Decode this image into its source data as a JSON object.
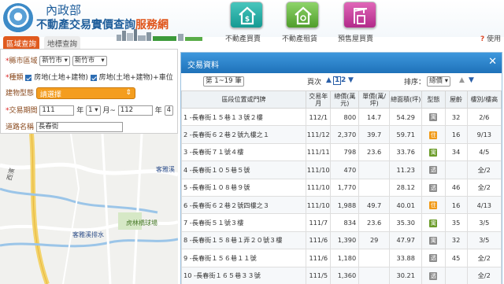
{
  "header": {
    "org": "內政部",
    "title_main": "不動產交易實價查詢",
    "title_accent": "服務網",
    "nav": [
      {
        "label": "不動產買賣",
        "icon": "house-dollar-icon"
      },
      {
        "label": "不動產租賃",
        "icon": "house-key-icon"
      },
      {
        "label": "預售屋買賣",
        "icon": "crane-building-icon"
      }
    ],
    "help": "使用"
  },
  "tabs": {
    "area": "區域查詢",
    "map": "地標查詢"
  },
  "filter": {
    "city_label": "縣市區域",
    "city_value": "新竹市",
    "district_value": "新竹市",
    "type_label": "種類",
    "type_opt1": "房地(土地+建物)",
    "type_opt2": "房地(土地+建物)+車位",
    "building_label": "建物型態",
    "building_value": "請選擇",
    "period_label": "交易期間",
    "year_from": "111",
    "unit_year": "年",
    "month_from": "1",
    "unit_month_to": "月~",
    "year_to": "112",
    "month_to": "4",
    "road_label": "道路名稱",
    "road_value": "長春街"
  },
  "map_labels": {
    "a": "客雅溪",
    "b": "虎林橋球場",
    "c": "客雅溪排水",
    "d": "西濱"
  },
  "dialog": {
    "title": "交易資料",
    "page_select": "第 1~19 筆",
    "page_label": "頁次",
    "page_current": "1",
    "page_next": "2",
    "sort_label": "排序：",
    "sort_value": "總價",
    "columns": [
      "區段位置或門牌",
      "交易年月",
      "總價(萬元)",
      "單價(萬/坪)",
      "總面積(坪)",
      "型態",
      "屋齡",
      "樓別/樓高"
    ],
    "rows": [
      {
        "addr": "1 -長春街１５巷１３號２樓",
        "date": "112/1",
        "total": "800",
        "unit": "14.7",
        "area": "54.29",
        "type": "apt",
        "type_char": "寓",
        "age": "32",
        "floor": "2/6"
      },
      {
        "addr": "2 -長春街６２巷２號九樓之１",
        "date": "111/12",
        "total": "2,370",
        "unit": "39.7",
        "area": "59.71",
        "type": "shop",
        "type_char": "住",
        "age": "16",
        "floor": "9/13"
      },
      {
        "addr": "3 -長春街７１號４樓",
        "date": "111/11",
        "total": "798",
        "unit": "23.6",
        "area": "33.76",
        "type": "building",
        "type_char": "寓",
        "age": "34",
        "floor": "4/5"
      },
      {
        "addr": "4 -長春街１０５巷５號",
        "date": "111/10",
        "total": "470",
        "unit": "",
        "area": "11.23",
        "type": "apt",
        "type_char": "透",
        "age": "",
        "floor": "全/2"
      },
      {
        "addr": "5 -長春街１０８巷９號",
        "date": "111/10",
        "total": "1,770",
        "unit": "",
        "area": "28.12",
        "type": "apt",
        "type_char": "透",
        "age": "46",
        "floor": "全/2"
      },
      {
        "addr": "6 -長春街６２巷２號四樓之３",
        "date": "111/10",
        "total": "1,988",
        "unit": "49.7",
        "area": "40.01",
        "type": "shop",
        "type_char": "住",
        "age": "16",
        "floor": "4/13"
      },
      {
        "addr": "7 -長春街５１號３樓",
        "date": "111/7",
        "total": "834",
        "unit": "23.6",
        "area": "35.30",
        "type": "building",
        "type_char": "寓",
        "age": "35",
        "floor": "3/5"
      },
      {
        "addr": "8 -長春街１５８巷１弄２０號３樓",
        "date": "111/6",
        "total": "1,390",
        "unit": "29",
        "area": "47.97",
        "type": "apt",
        "type_char": "寓",
        "age": "32",
        "floor": "3/5"
      },
      {
        "addr": "9 -長春街１５６巷１１號",
        "date": "111/6",
        "total": "1,180",
        "unit": "",
        "area": "33.88",
        "type": "apt",
        "type_char": "透",
        "age": "45",
        "floor": "全/2"
      },
      {
        "addr": "10 -長春街１６５巷３３號",
        "date": "111/5",
        "total": "1,360",
        "unit": "",
        "area": "30.21",
        "type": "apt",
        "type_char": "透",
        "age": "",
        "floor": "全/2"
      }
    ]
  },
  "colors": {
    "brand_blue": "#1f5e9b",
    "accent_orange": "#e05a1e",
    "dialog_header": "#1f72b9"
  }
}
